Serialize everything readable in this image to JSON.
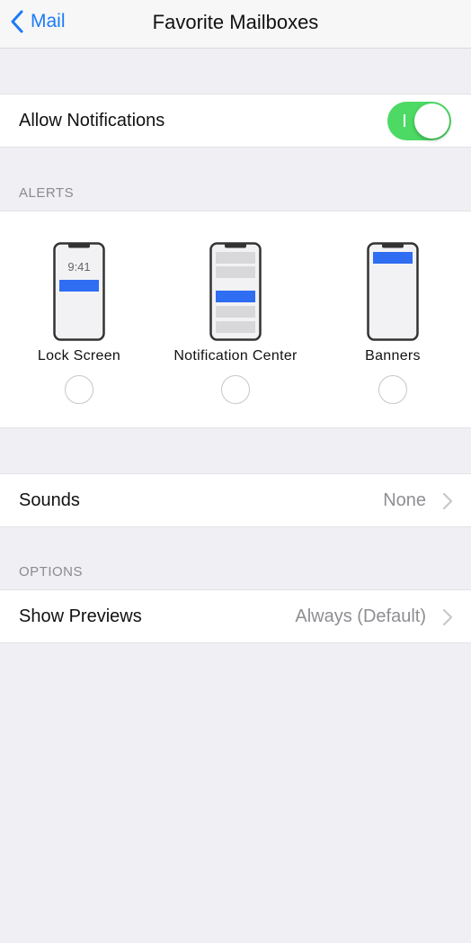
{
  "navbar": {
    "back_label": "Mail",
    "title": "Favorite Mailboxes"
  },
  "notifications": {
    "label": "Allow Notifications",
    "enabled": true
  },
  "alerts": {
    "header": "ALERTS",
    "lock_screen_time": "9:41",
    "options": [
      {
        "label": "Lock Screen",
        "selected": false
      },
      {
        "label": "Notification Center",
        "selected": false
      },
      {
        "label": "Banners",
        "selected": false
      }
    ]
  },
  "sounds": {
    "label": "Sounds",
    "value": "None"
  },
  "options": {
    "header": "OPTIONS",
    "show_previews": {
      "label": "Show Previews",
      "value": "Always (Default)"
    }
  },
  "colors": {
    "accent": "#1a7bf7",
    "toggle_on": "#4cd964",
    "banner_blue": "#2f6df2",
    "background": "#efeff4"
  }
}
